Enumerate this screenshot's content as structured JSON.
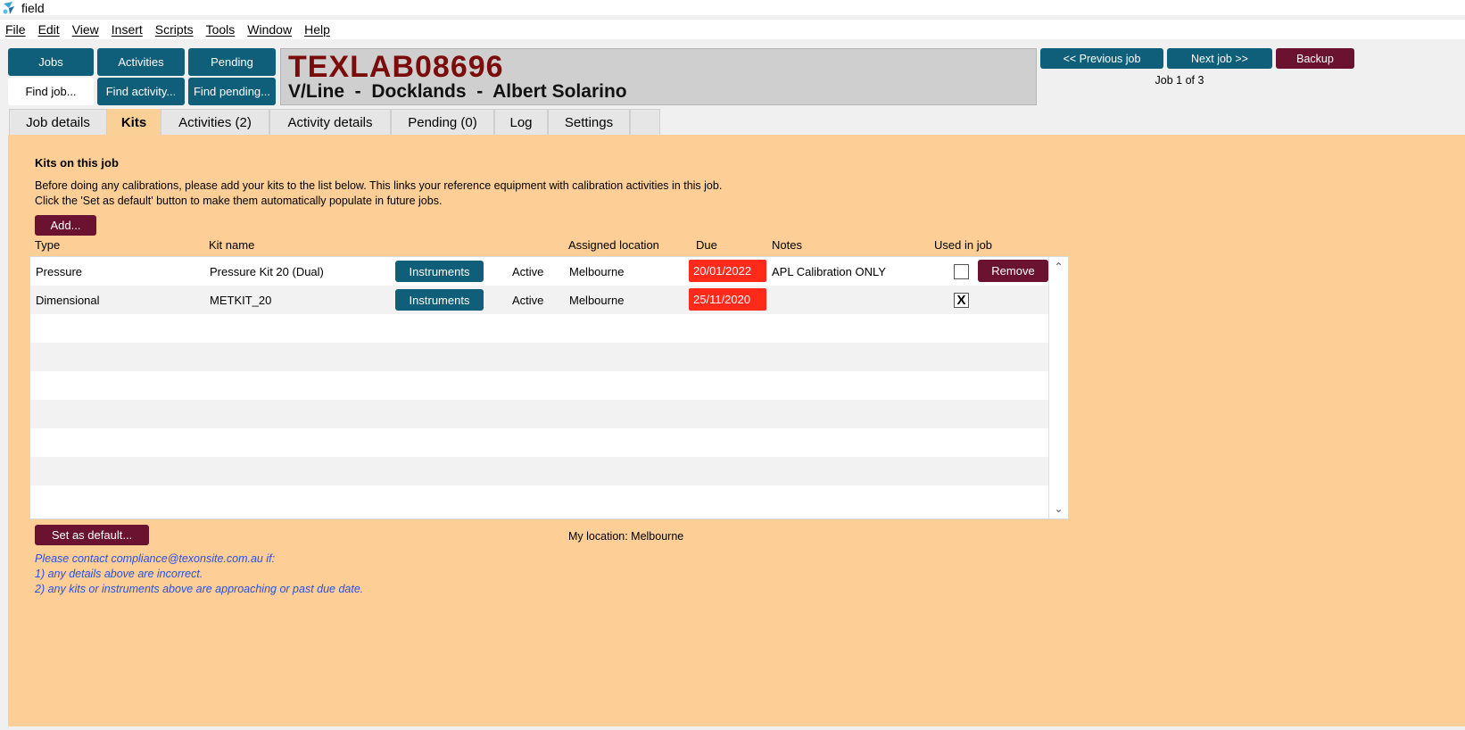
{
  "window": {
    "title": "field"
  },
  "menu": [
    "File",
    "Edit",
    "View",
    "Insert",
    "Scripts",
    "Tools",
    "Window",
    "Help"
  ],
  "nav": {
    "jobs": "Jobs",
    "activities": "Activities",
    "pending": "Pending",
    "find_job": "Find job...",
    "find_activity": "Find activity...",
    "find_pending": "Find pending..."
  },
  "header": {
    "job_code": "TEXLAB08696",
    "subtitle": "V/Line  -  Docklands  -  Albert Solarino"
  },
  "job_nav": {
    "previous": "<< Previous job",
    "next": "Next job >>",
    "backup": "Backup",
    "count": "Job 1 of 3"
  },
  "tabs": [
    "Job details",
    "Kits",
    "Activities (2)",
    "Activity details",
    "Pending (0)",
    "Log",
    "Settings"
  ],
  "active_tab": "Kits",
  "kits": {
    "title": "Kits on this job",
    "intro_line1": "Before doing any calibrations, please add your kits to the list below. This links your reference equipment with calibration activities in this job.",
    "intro_line2": "Click the 'Set as default' button to make them automatically populate in future jobs.",
    "add_button": "Add...",
    "columns": {
      "type": "Type",
      "kit_name": "Kit name",
      "assigned_location": "Assigned location",
      "due": "Due",
      "notes": "Notes",
      "used_in_job": "Used in job"
    },
    "rows": [
      {
        "type": "Pressure",
        "kit_name": "Pressure Kit 20 (Dual)",
        "instruments": "Instruments",
        "status": "Active",
        "location": "Melbourne",
        "due": "20/01/2022",
        "notes": "APL Calibration ONLY",
        "used": "",
        "remove": "Remove"
      },
      {
        "type": "Dimensional",
        "kit_name": "METKIT_20",
        "instruments": "Instruments",
        "status": "Active",
        "location": "Melbourne",
        "due": "25/11/2020",
        "notes": "",
        "used": "X"
      }
    ],
    "set_default_button": "Set as default...",
    "my_location": "My location: Melbourne",
    "contact_line1": "Please contact compliance@texonsite.com.au if:",
    "contact_line2": "1) any details above are incorrect.",
    "contact_line3": "2) any kits or instruments above are approaching or past due date."
  },
  "colors": {
    "teal": "#0f5e7a",
    "maroon": "#6b1230",
    "panel": "#fdcf96",
    "overdue": "#ff2a1a",
    "contact_text": "#2b4fe0"
  }
}
